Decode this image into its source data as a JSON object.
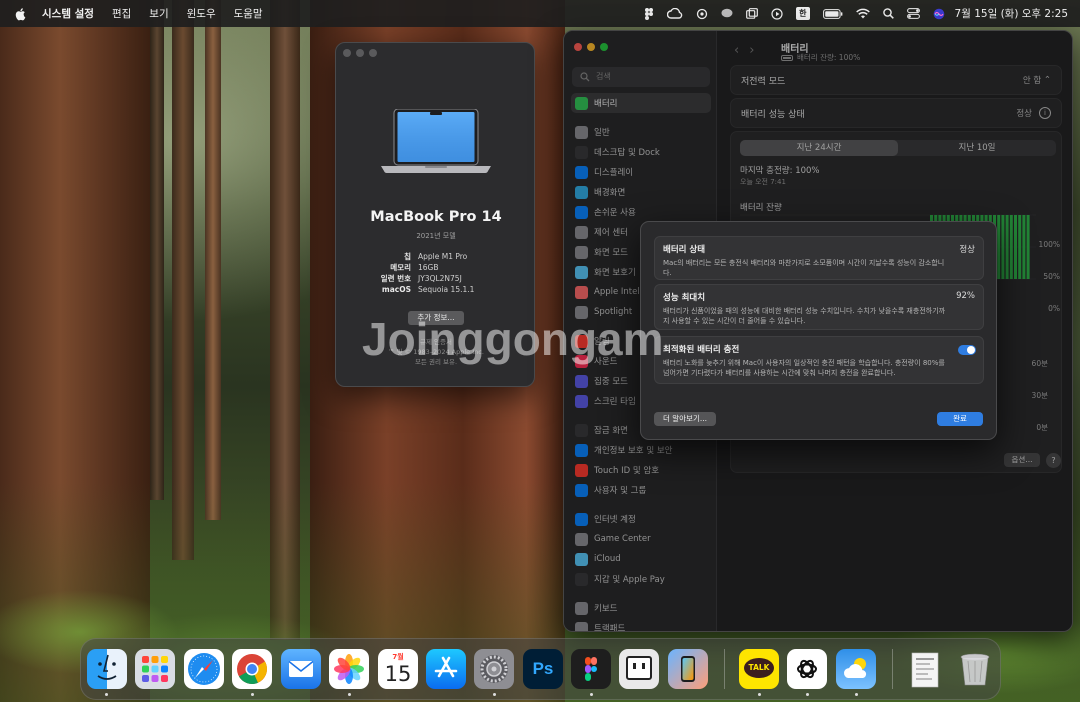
{
  "menubar": {
    "app_name": "시스템 설정",
    "menus": [
      "편집",
      "보기",
      "윈도우",
      "도움말"
    ],
    "input_badge": "한",
    "clock": "7월 15일 (화) 오후 2:25"
  },
  "about": {
    "model": "MacBook Pro 14",
    "year": "2021년 모델",
    "specs": [
      {
        "key": "칩",
        "value": "Apple M1 Pro"
      },
      {
        "key": "메모리",
        "value": "16GB"
      },
      {
        "key": "일련 번호",
        "value": "JY3QL2N75J"
      },
      {
        "key": "macOS",
        "value": "Sequoia 15.1.1"
      }
    ],
    "more_info_button": "추가 정보...",
    "legal_1": "규제 인증서",
    "legal_2": "™ 및 © 1983–2024 Apple Inc.",
    "legal_3": "모든 권리 보유."
  },
  "settings": {
    "search_placeholder": "검색",
    "sidebar": [
      {
        "label": "배터리",
        "color": "#34c759",
        "selected": true
      },
      {
        "label": "",
        "gap": true
      },
      {
        "label": "일반",
        "color": "#8e8e93"
      },
      {
        "label": "데스크탑 및 Dock",
        "color": "#3a3a3c"
      },
      {
        "label": "디스플레이",
        "color": "#0a84ff"
      },
      {
        "label": "배경화면",
        "color": "#32ade6"
      },
      {
        "label": "손쉬운 사용",
        "color": "#0a84ff"
      },
      {
        "label": "제어 센터",
        "color": "#8e8e93"
      },
      {
        "label": "화면 모드",
        "color": "#8e8e93"
      },
      {
        "label": "화면 보호기",
        "color": "#5ac8fa"
      },
      {
        "label": "Apple Intelligence",
        "color": "#ff6b6b"
      },
      {
        "label": "Spotlight",
        "color": "#8e8e93"
      },
      {
        "label": "",
        "gap": true
      },
      {
        "label": "알림",
        "color": "#ff3b30"
      },
      {
        "label": "사운드",
        "color": "#ff2d55"
      },
      {
        "label": "집중 모드",
        "color": "#5e5ce6"
      },
      {
        "label": "스크린 타임",
        "color": "#5e5ce6"
      },
      {
        "label": "",
        "gap": true
      },
      {
        "label": "잠금 화면",
        "color": "#3a3a3c"
      },
      {
        "label": "개인정보 보호 및 보안",
        "color": "#0a84ff"
      },
      {
        "label": "Touch ID 및 암호",
        "color": "#ff3b30"
      },
      {
        "label": "사용자 및 그룹",
        "color": "#0a84ff"
      },
      {
        "label": "",
        "gap": true
      },
      {
        "label": "인터넷 계정",
        "color": "#0a84ff"
      },
      {
        "label": "Game Center",
        "color": "#8e8e93"
      },
      {
        "label": "iCloud",
        "color": "#5ac8fa"
      },
      {
        "label": "지갑 및 Apple Pay",
        "color": "#3a3a3c"
      },
      {
        "label": "",
        "gap": true
      },
      {
        "label": "키보드",
        "color": "#8e8e93"
      },
      {
        "label": "트랙패드",
        "color": "#8e8e93"
      }
    ],
    "page_title": "배터리",
    "page_subtitle": "배터리 잔량: 100%",
    "low_power_label": "저전력 모드",
    "low_power_value": "안 함",
    "health_label": "배터리 성능 상태",
    "health_value": "정상",
    "tabs": [
      "지난 24시간",
      "지난 10일"
    ],
    "last_charge": "마지막 충전량: 100%",
    "last_charge_time": "오늘 오전 7:41",
    "battery_level_label": "배터리 잔량",
    "pct_ticks": [
      "100%",
      "50%",
      "0%"
    ],
    "screen_time_ticks": [
      "60분",
      "30분",
      "0분"
    ],
    "options_button": "옵션...",
    "help_button": "?"
  },
  "sheet": {
    "health_title": "배터리 상태",
    "health_value": "정상",
    "health_desc": "Mac의 배터리는 모든 충전식 배터리와 마찬가지로 소모품이며 시간이 지날수록 성능이 감소합니다.",
    "capacity_title": "성능 최대치",
    "capacity_value": "92%",
    "capacity_desc": "배터리가 신품이었을 때의 성능에 대비한 배터리 성능 수치입니다. 수치가 낮을수록 재충전하기까지 사용할 수 있는 시간이 더 줄어들 수 있습니다.",
    "optimized_title": "최적화된 배터리 충전",
    "optimized_desc": "배터리 노화를 늦추기 위해 Mac이 사용자의 일상적인 충전 패턴을 학습합니다. 충전량이 80%를 넘어가면 기다렸다가 배터리를 사용하는 시간에 맞춰 나머지 충전을 완료합니다.",
    "optimized_enabled": true,
    "learn_more_button": "더 알아보기...",
    "done_button": "완료"
  },
  "watermark": "Joinggongam",
  "dock": {
    "apps": [
      "finder",
      "launchpad",
      "safari",
      "chrome",
      "mail",
      "photos",
      "calendar",
      "app-store",
      "system-settings",
      "photoshop",
      "figma",
      "pixel-app",
      "iphone-mirroring",
      "kakaotalk",
      "chatgpt",
      "weather",
      "downloads-stack",
      "trash"
    ],
    "calendar_month": "7월",
    "calendar_day": "15",
    "photoshop_label": "Ps",
    "kakao_label": "TALK"
  }
}
